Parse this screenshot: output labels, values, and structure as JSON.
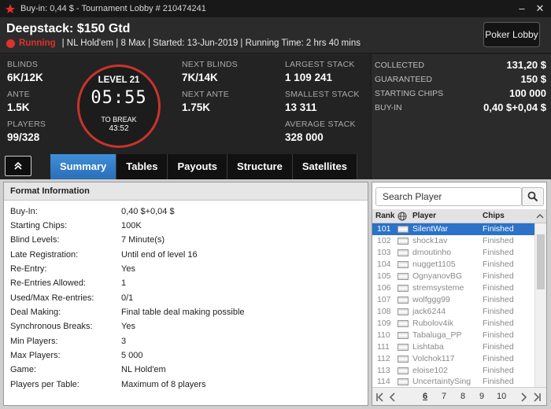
{
  "window": {
    "title": "Buy-in: 0,44 $ - Tournament Lobby # 210474241",
    "minimize": "–",
    "close": "✕"
  },
  "header": {
    "title": "Deepstack: $150 Gtd",
    "status": "Running",
    "info": "| NL Hold'em | 8 Max | Started: 13-Jun-2019 | Running Time: 2 hrs  40 mins",
    "lobby_button": "Poker Lobby"
  },
  "stats": {
    "blinds_label": "BLINDS",
    "blinds": "6K/12K",
    "ante_label": "ANTE",
    "ante": "1.5K",
    "players_label": "PLAYERS",
    "players": "99/328",
    "next_blinds_label": "NEXT BLINDS",
    "next_blinds": "7K/14K",
    "next_ante_label": "NEXT ANTE",
    "next_ante": "1.75K",
    "largest_label": "LARGEST STACK",
    "largest": "1 109 241",
    "smallest_label": "SMALLEST STACK",
    "smallest": "13 311",
    "average_label": "AVERAGE STACK",
    "average": "328 000"
  },
  "clock": {
    "level": "LEVEL 21",
    "time": "05:55",
    "break_label": "TO BREAK",
    "break_time": "43:52"
  },
  "prize": {
    "collected_label": "COLLECTED",
    "collected": "131,20 $",
    "guaranteed_label": "GUARANTEED",
    "guaranteed": "150 $",
    "starting_chips_label": "STARTING CHIPS",
    "starting_chips": "100 000",
    "buyin_label": "BUY-IN",
    "buyin": "0,40 $+0,04 $"
  },
  "tabs": [
    "Summary",
    "Tables",
    "Payouts",
    "Structure",
    "Satellites"
  ],
  "format": {
    "heading": "Format Information",
    "rows": [
      {
        "k": "Buy-In:",
        "v": "0,40 $+0,04 $"
      },
      {
        "k": "Starting Chips:",
        "v": "100K"
      },
      {
        "k": "Blind Levels:",
        "v": "7 Minute(s)"
      },
      {
        "k": "Late Registration:",
        "v": "Until end of level 16"
      },
      {
        "k": "Re-Entry:",
        "v": "Yes"
      },
      {
        "k": "Re-Entries Allowed:",
        "v": "1"
      },
      {
        "k": "Used/Max Re-entries:",
        "v": "0/1"
      },
      {
        "k": "Deal Making:",
        "v": "Final table deal making possible"
      },
      {
        "k": "Synchronous Breaks:",
        "v": "Yes"
      },
      {
        "k": "Min Players:",
        "v": "3"
      },
      {
        "k": "Max Players:",
        "v": "5 000"
      },
      {
        "k": "Game:",
        "v": "NL Hold'em"
      },
      {
        "k": "Players per Table:",
        "v": "Maximum of 8 players"
      }
    ]
  },
  "players_list": {
    "search_placeholder": "Search Player",
    "col_rank": "Rank",
    "col_player": "Player",
    "col_chips": "Chips",
    "rows": [
      {
        "rank": "101",
        "name": "SilentWar",
        "chips": "Finished"
      },
      {
        "rank": "102",
        "name": "shock1av",
        "chips": "Finished"
      },
      {
        "rank": "103",
        "name": "dmoutinho",
        "chips": "Finished"
      },
      {
        "rank": "104",
        "name": "nugget1105",
        "chips": "Finished"
      },
      {
        "rank": "105",
        "name": "OgnyanovBG",
        "chips": "Finished"
      },
      {
        "rank": "106",
        "name": "stremsysteme",
        "chips": "Finished"
      },
      {
        "rank": "107",
        "name": "wolfggg99",
        "chips": "Finished"
      },
      {
        "rank": "108",
        "name": "jack6244",
        "chips": "Finished"
      },
      {
        "rank": "109",
        "name": "Rubolov4ik",
        "chips": "Finished"
      },
      {
        "rank": "110",
        "name": "Tabaluga_PP",
        "chips": "Finished"
      },
      {
        "rank": "111",
        "name": "Lishtaba",
        "chips": "Finished"
      },
      {
        "rank": "112",
        "name": "Volchok117",
        "chips": "Finished"
      },
      {
        "rank": "113",
        "name": "eloise102",
        "chips": "Finished"
      },
      {
        "rank": "114",
        "name": "UncertaintySing",
        "chips": "Finished"
      }
    ],
    "pages": [
      "6",
      "7",
      "8",
      "9",
      "10"
    ]
  },
  "colors": {
    "accent": "#2b72c8",
    "running": "#e0312c",
    "clock_ring": "#c8342c"
  }
}
